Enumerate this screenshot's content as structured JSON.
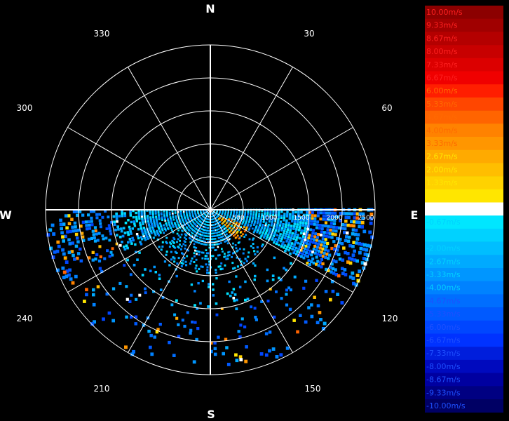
{
  "chart_data": {
    "type": "heatmap",
    "projection": "polar",
    "grid": true,
    "cardinal_labels": [
      "N",
      "E",
      "S",
      "W"
    ],
    "azimuth_ticks": [
      "30",
      "60",
      "120",
      "150",
      "210",
      "240",
      "300",
      "330"
    ],
    "range_ticks": [
      "500",
      "1000",
      "1500",
      "2000",
      "2500"
    ],
    "legend_placement": "right",
    "colorbar": {
      "labels": [
        "10.00m/s",
        "9.33m/s",
        "8.67m/s",
        "8.00m/s",
        "7.33m/s",
        "6.67m/s",
        "6.00m/s",
        "5.33m/s",
        "4.67m/s",
        "4.00m/s",
        "3.33m/s",
        "2.67m/s",
        "2.00m/s",
        "1.33m/s",
        "0.67m/s",
        "0.00m/s",
        "-0.67m/s",
        "-1.33m/s",
        "-2.00m/s",
        "-2.67m/s",
        "-3.33m/s",
        "-4.00m/s",
        "-4.67m/s",
        "-5.33m/s",
        "-6.00m/s",
        "-6.67m/s",
        "-7.33m/s",
        "-8.00m/s",
        "-8.67m/s",
        "-9.33m/s",
        "-10.00m/s"
      ],
      "colors": [
        "#8c0000",
        "#a00000",
        "#b40000",
        "#c80000",
        "#dc0000",
        "#f00000",
        "#ff1e00",
        "#ff4600",
        "#ff6400",
        "#ff8200",
        "#ff9600",
        "#ffaa00",
        "#ffbe00",
        "#ffd200",
        "#ffe600",
        "#ffffff",
        "#00e6ff",
        "#00d2ff",
        "#00beff",
        "#00aaff",
        "#0096ff",
        "#0082ff",
        "#006eff",
        "#005aff",
        "#0046ff",
        "#0032ff",
        "#001edc",
        "#000abe",
        "#0000a0",
        "#000082",
        "#000064"
      ]
    },
    "scan": {
      "azimuth_range_deg": [
        90,
        270
      ],
      "max_range": 2500
    }
  }
}
